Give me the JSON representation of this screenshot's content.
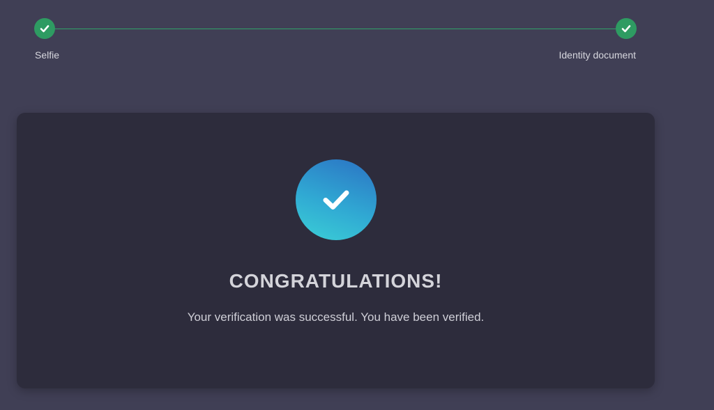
{
  "stepper": {
    "steps": [
      {
        "label": "Selfie",
        "status": "completed",
        "icon": "check-icon"
      },
      {
        "label": "Identity document",
        "status": "completed",
        "icon": "check-icon"
      }
    ],
    "accent_color": "#2e9b62"
  },
  "card": {
    "icon": "check-icon",
    "title": "CONGRATULATIONS!",
    "message": "Your verification was successful. You have been verified."
  }
}
